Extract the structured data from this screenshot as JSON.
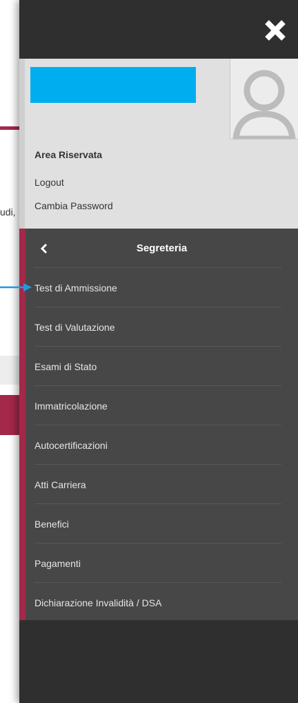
{
  "background": {
    "partial_text": "udi,"
  },
  "drawer": {
    "close_icon": "close-x-icon",
    "user": {
      "avatar_icon": "user-avatar-icon",
      "area_title": "Area Riservata",
      "logout": "Logout",
      "change_password": "Cambia Password"
    },
    "menu": {
      "back_icon": "chevron-left-icon",
      "title": "Segreteria",
      "items": [
        {
          "label": "Test di Ammissione"
        },
        {
          "label": "Test di Valutazione"
        },
        {
          "label": "Esami di Stato"
        },
        {
          "label": "Immatricolazione"
        },
        {
          "label": "Autocertificazioni"
        },
        {
          "label": "Atti Carriera"
        },
        {
          "label": "Benefici"
        },
        {
          "label": "Pagamenti"
        },
        {
          "label": "Dichiarazione Invalidità / DSA"
        }
      ]
    }
  },
  "colors": {
    "accent": "#a3284a",
    "name_bar": "#00aeef",
    "annotation_arrow": "#1e9be0",
    "drawer_dark": "#2f2f2f",
    "menu_bg": "#474747"
  }
}
